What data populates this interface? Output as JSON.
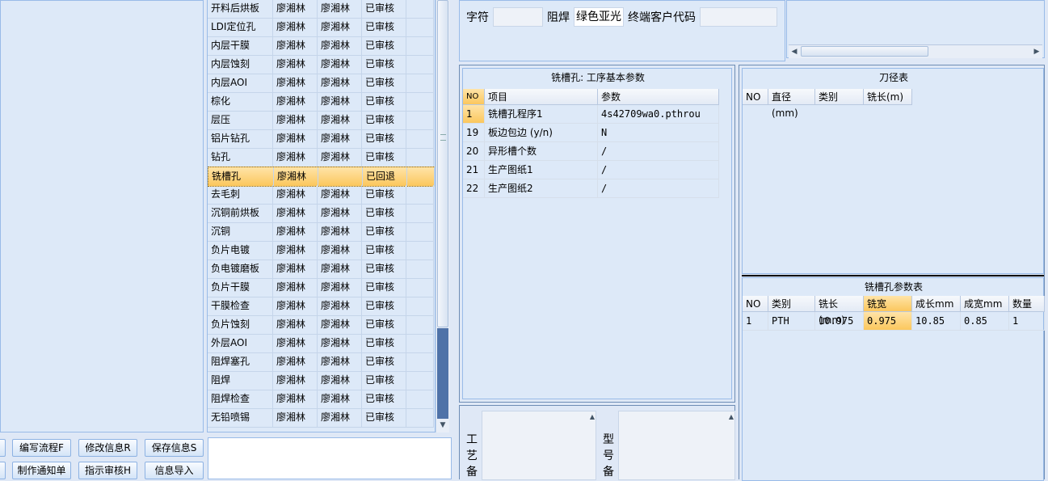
{
  "process_list": {
    "rows": [
      {
        "name": "开料后烘板",
        "p1": "廖湘林",
        "p2": "廖湘林",
        "status": "已审核"
      },
      {
        "name": "LDI定位孔",
        "p1": "廖湘林",
        "p2": "廖湘林",
        "status": "已审核"
      },
      {
        "name": "内层干膜",
        "p1": "廖湘林",
        "p2": "廖湘林",
        "status": "已审核"
      },
      {
        "name": "内层蚀刻",
        "p1": "廖湘林",
        "p2": "廖湘林",
        "status": "已审核"
      },
      {
        "name": "内层AOI",
        "p1": "廖湘林",
        "p2": "廖湘林",
        "status": "已审核"
      },
      {
        "name": "棕化",
        "p1": "廖湘林",
        "p2": "廖湘林",
        "status": "已审核"
      },
      {
        "name": "层压",
        "p1": "廖湘林",
        "p2": "廖湘林",
        "status": "已审核"
      },
      {
        "name": "铝片钻孔",
        "p1": "廖湘林",
        "p2": "廖湘林",
        "status": "已审核"
      },
      {
        "name": "钻孔",
        "p1": "廖湘林",
        "p2": "廖湘林",
        "status": "已审核"
      },
      {
        "name": "铣槽孔",
        "p1": "廖湘林",
        "p2": "",
        "status": "已回退",
        "selected": true
      },
      {
        "name": "去毛刺",
        "p1": "廖湘林",
        "p2": "廖湘林",
        "status": "已审核"
      },
      {
        "name": "沉铜前烘板",
        "p1": "廖湘林",
        "p2": "廖湘林",
        "status": "已审核"
      },
      {
        "name": "沉铜",
        "p1": "廖湘林",
        "p2": "廖湘林",
        "status": "已审核"
      },
      {
        "name": "负片电镀",
        "p1": "廖湘林",
        "p2": "廖湘林",
        "status": "已审核"
      },
      {
        "name": "负电镀磨板",
        "p1": "廖湘林",
        "p2": "廖湘林",
        "status": "已审核"
      },
      {
        "name": "负片干膜",
        "p1": "廖湘林",
        "p2": "廖湘林",
        "status": "已审核"
      },
      {
        "name": "干膜检查",
        "p1": "廖湘林",
        "p2": "廖湘林",
        "status": "已审核"
      },
      {
        "name": "负片蚀刻",
        "p1": "廖湘林",
        "p2": "廖湘林",
        "status": "已审核"
      },
      {
        "name": "外层AOI",
        "p1": "廖湘林",
        "p2": "廖湘林",
        "status": "已审核"
      },
      {
        "name": "阻焊塞孔",
        "p1": "廖湘林",
        "p2": "廖湘林",
        "status": "已审核"
      },
      {
        "name": "阻焊",
        "p1": "廖湘林",
        "p2": "廖湘林",
        "status": "已审核"
      },
      {
        "name": "阻焊检查",
        "p1": "廖湘林",
        "p2": "廖湘林",
        "status": "已审核"
      },
      {
        "name": "无铅喷锡",
        "p1": "廖湘林",
        "p2": "廖湘林",
        "status": "已审核"
      }
    ]
  },
  "buttons": {
    "edit_flow": "编写流程F",
    "modify_info": "修改信息R",
    "save_info": "保存信息S",
    "make_notice": "制作通知单",
    "instruct_review": "指示审核H",
    "import_info": "信息导入"
  },
  "top_fields": {
    "char_label": "字符",
    "solder_label": "阻焊",
    "solder_value": "绿色亚光",
    "customer_code_label": "终端客户代码"
  },
  "basic_params": {
    "title": "铣槽孔: 工序基本参数",
    "headers": [
      "NO",
      "项目",
      "参数"
    ],
    "rows": [
      {
        "no": "1",
        "item": "铣槽孔程序1",
        "param": "4s42709wa0.pthrou"
      },
      {
        "no": "19",
        "item": "板边包边 (y/n)",
        "param": "N"
      },
      {
        "no": "20",
        "item": "异形槽个数",
        "param": "/"
      },
      {
        "no": "21",
        "item": "生产图纸1",
        "param": "/"
      },
      {
        "no": "22",
        "item": "生产图纸2",
        "param": "/"
      }
    ]
  },
  "tool_table": {
    "title": "刀径表",
    "headers": [
      "NO",
      "直径(mm)",
      "类别",
      "铣长(m)"
    ]
  },
  "slot_params": {
    "title": "铣槽孔参数表",
    "headers": [
      "NO",
      "类别",
      "铣长(mm)",
      "铣宽(mm)",
      "成长mm",
      "成宽mm",
      "数量"
    ],
    "rows": [
      {
        "no": "1",
        "type": "PTH",
        "len": "10.975",
        "width": "0.975",
        "fin_len": "10.85",
        "fin_width": "0.85",
        "qty": "1"
      }
    ]
  },
  "notes": {
    "process_note_label": [
      "工",
      "艺",
      "备"
    ],
    "model_note_label": [
      "型",
      "号",
      "备"
    ]
  }
}
